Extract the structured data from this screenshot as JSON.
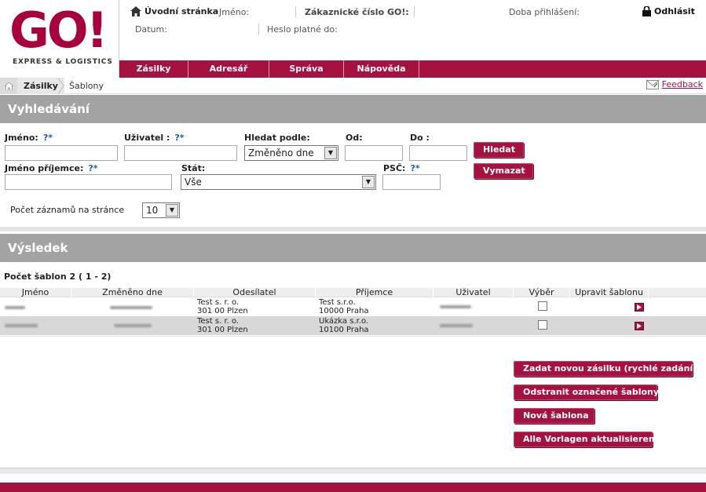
{
  "brand": {
    "logo_text": "GO!",
    "tagline": "EXPRESS & LOGISTICS",
    "color": "#a6123f"
  },
  "header": {
    "home": "Úvodní stránka",
    "name_label": "Jméno:",
    "customer_label": "Zákaznické číslo GO!:",
    "login_time_label": "Doba přihlášení:",
    "logout": "Odhlásit",
    "date_label": "Datum:",
    "password_label": "Heslo platné do:"
  },
  "nav": [
    "Zásilky",
    "Adresář",
    "Správa",
    "Nápověda"
  ],
  "breadcrumb": {
    "item1": "Zásilky",
    "item2": "Šablony",
    "feedback": "Feedback"
  },
  "search": {
    "title": "Vyhledávání",
    "name_label": "Jméno:",
    "user_label": "Uživatel :",
    "search_by_label": "Hledat podle:",
    "search_by_value": "Změněno dne",
    "from_label": "Od:",
    "to_label": "Do :",
    "recipient_label": "Jméno příjemce:",
    "state_label": "Stát:",
    "state_value": "Vše",
    "zip_label": "PSČ:",
    "help_mark": "?*",
    "search_button": "Hledat",
    "clear_button": "Vymazat",
    "per_page_label": "Počet záznamů na stránce",
    "per_page_value": "10"
  },
  "results": {
    "title": "Výsledek",
    "count": "Počet šablon 2 ( 1 - 2)",
    "columns": [
      "Jméno",
      "Změněno dne",
      "Odesílatel",
      "Příjemce",
      "Uživatel",
      "Výběr",
      "Upravit šablonu"
    ],
    "rows": [
      {
        "sender1": "Test s. r. o.",
        "sender2": "301 00  Plzen",
        "rec1": "Test s.r.o.",
        "rec2": "10000  Praha"
      },
      {
        "sender1": "Test s. r. o.",
        "sender2": "301 00  Plzen",
        "rec1": "Ukázka s.r.o.",
        "rec2": "10100  Praha"
      }
    ]
  },
  "actions": {
    "new_quick": "Zadat novou zásilku (rychlé zadání)",
    "remove": "Odstranit označené šablony",
    "new_template": "Nová šablona",
    "update_all": "Alle Vorlagen aktualisieren"
  }
}
